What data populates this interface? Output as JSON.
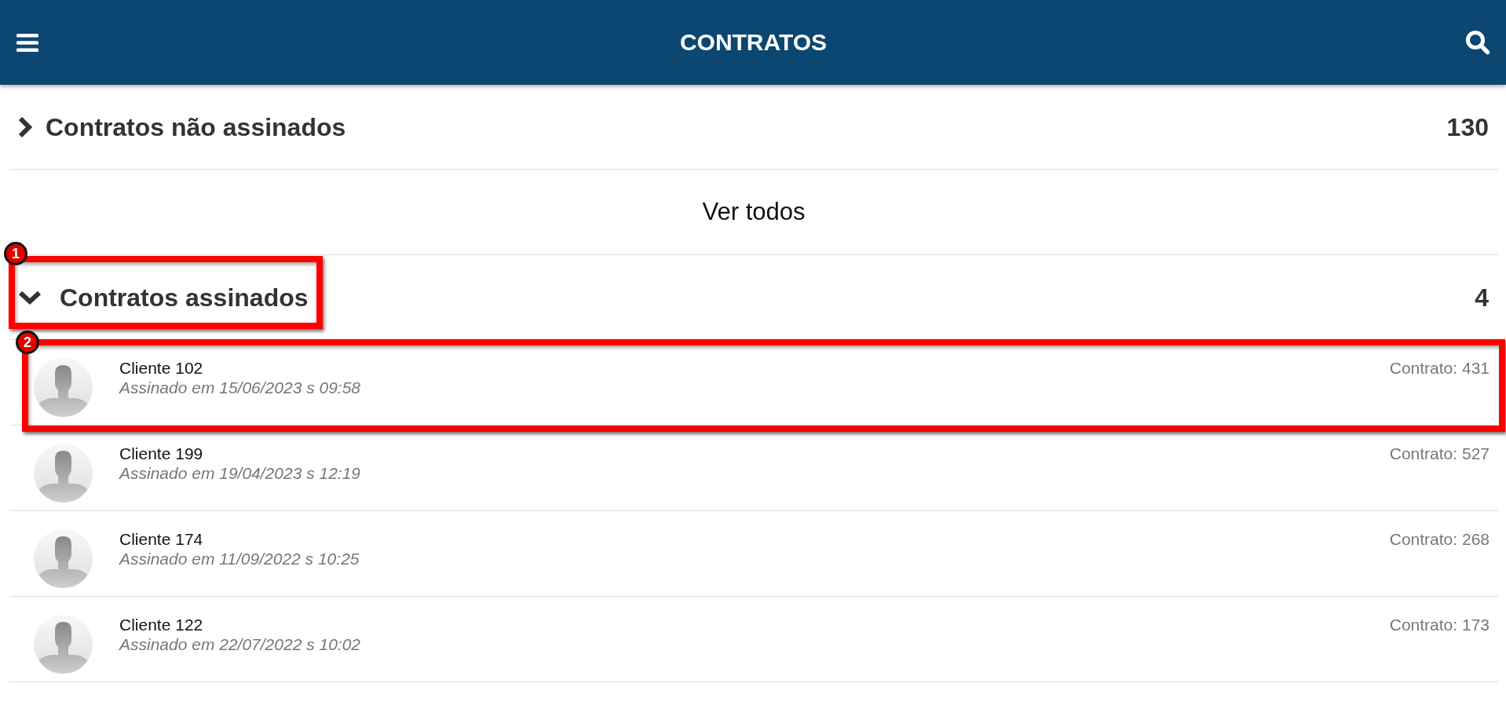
{
  "header": {
    "title": "CONTRATOS"
  },
  "sections": [
    {
      "title": "Contratos não assinados",
      "count": "130",
      "expanded": false,
      "footer_link": "Ver todos"
    },
    {
      "title": "Contratos assinados",
      "count": "4",
      "expanded": true,
      "callout": "1",
      "items": [
        {
          "name": "Cliente 102",
          "signed": "Assinado em 15/06/2023 s 09:58",
          "contract": "Contrato: 431",
          "callout": "2"
        },
        {
          "name": "Cliente 199",
          "signed": "Assinado em 19/04/2023 s 12:19",
          "contract": "Contrato: 527"
        },
        {
          "name": "Cliente 174",
          "signed": "Assinado em 11/09/2022 s 10:25",
          "contract": "Contrato: 268"
        },
        {
          "name": "Cliente 122",
          "signed": "Assinado em 22/07/2022 s 10:02",
          "contract": "Contrato: 173"
        }
      ]
    }
  ]
}
